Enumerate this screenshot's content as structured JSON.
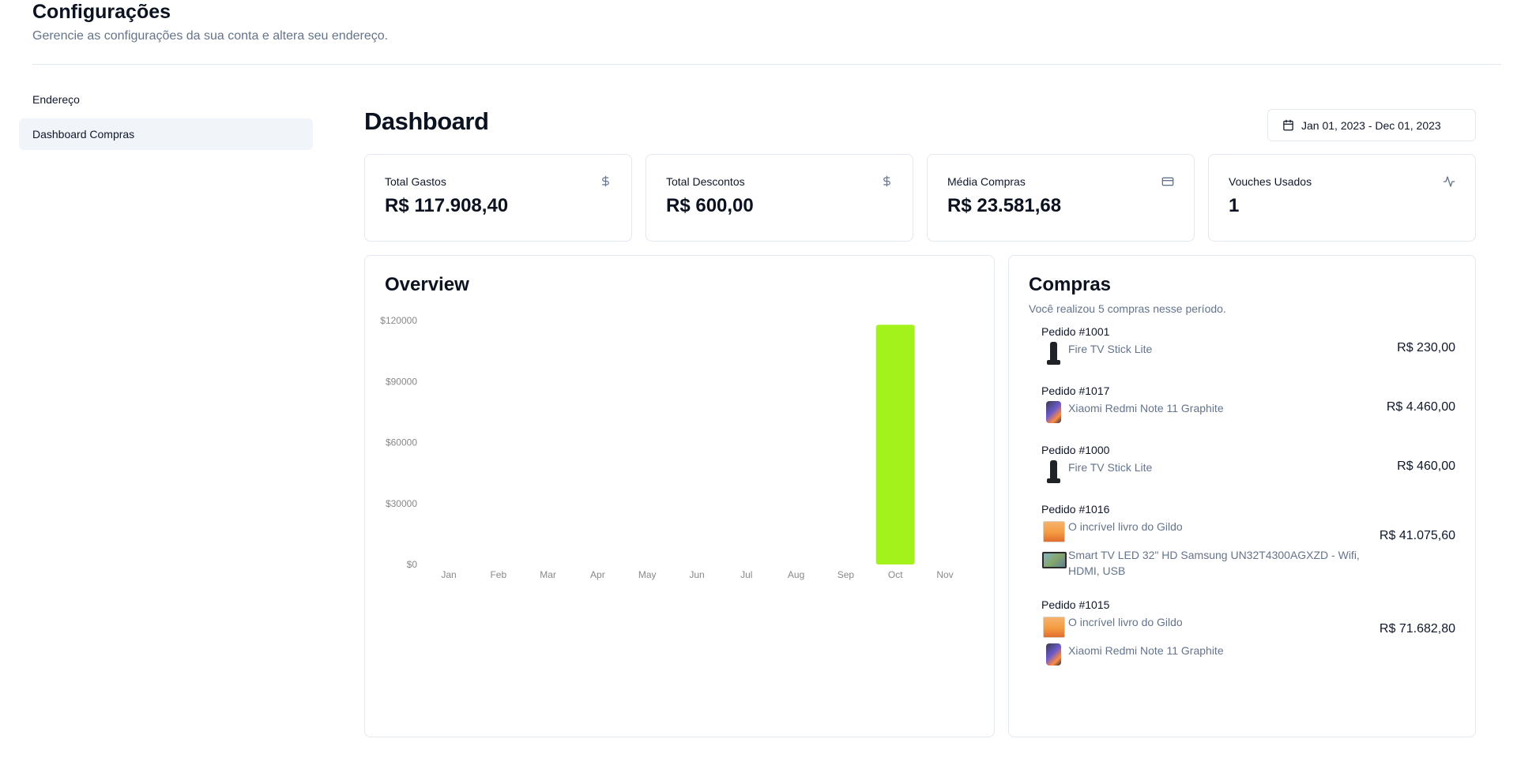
{
  "header": {
    "title": "Configurações",
    "subtitle": "Gerencie as configurações da sua conta e altera seu endereço."
  },
  "sidebar": {
    "items": [
      {
        "label": "Endereço",
        "active": false
      },
      {
        "label": "Dashboard Compras",
        "active": true
      }
    ]
  },
  "dashboard": {
    "title": "Dashboard",
    "date_range": "Jan 01, 2023 - Dec 01, 2023"
  },
  "stats": [
    {
      "title": "Total Gastos",
      "value": "R$ 117.908,40",
      "icon": "dollar-icon"
    },
    {
      "title": "Total Descontos",
      "value": "R$ 600,00",
      "icon": "dollar-icon"
    },
    {
      "title": "Média Compras",
      "value": "R$ 23.581,68",
      "icon": "credit-card-icon"
    },
    {
      "title": "Vouches Usados",
      "value": "1",
      "icon": "activity-icon"
    }
  ],
  "overview": {
    "title": "Overview"
  },
  "chart_data": {
    "type": "bar",
    "categories": [
      "Jan",
      "Feb",
      "Mar",
      "Apr",
      "May",
      "Jun",
      "Jul",
      "Aug",
      "Sep",
      "Oct",
      "Nov"
    ],
    "values": [
      0,
      0,
      0,
      0,
      0,
      0,
      0,
      0,
      0,
      117908.4,
      0
    ],
    "yticks": [
      "$0",
      "$30000",
      "$60000",
      "$90000",
      "$120000"
    ],
    "ytick_values": [
      0,
      30000,
      60000,
      90000,
      120000
    ],
    "ylim": [
      0,
      120000
    ],
    "bar_color": "#a3f21c",
    "xlabel": "",
    "ylabel": ""
  },
  "compras": {
    "title": "Compras",
    "subtitle": "Você realizou 5 compras nesse período.",
    "orders": [
      {
        "id": "Pedido #1001",
        "total": "R$ 230,00",
        "items": [
          {
            "name": "Fire TV Stick Lite",
            "thumb": "firetv"
          }
        ]
      },
      {
        "id": "Pedido #1017",
        "total": "R$ 4.460,00",
        "items": [
          {
            "name": "Xiaomi Redmi Note 11 Graphite",
            "thumb": "phone"
          }
        ]
      },
      {
        "id": "Pedido #1000",
        "total": "R$ 460,00",
        "items": [
          {
            "name": "Fire TV Stick Lite",
            "thumb": "firetv"
          }
        ]
      },
      {
        "id": "Pedido #1016",
        "total": "R$ 41.075,60",
        "items": [
          {
            "name": "O incrível livro do Gildo",
            "thumb": "book"
          },
          {
            "name": "Smart TV LED 32\" HD Samsung UN32T4300AGXZD - Wifi, HDMI, USB",
            "thumb": "tv"
          }
        ]
      },
      {
        "id": "Pedido #1015",
        "total": "R$ 71.682,80",
        "items": [
          {
            "name": "O incrível livro do Gildo",
            "thumb": "book"
          },
          {
            "name": "Xiaomi Redmi Note 11 Graphite",
            "thumb": "phone"
          }
        ]
      }
    ]
  }
}
